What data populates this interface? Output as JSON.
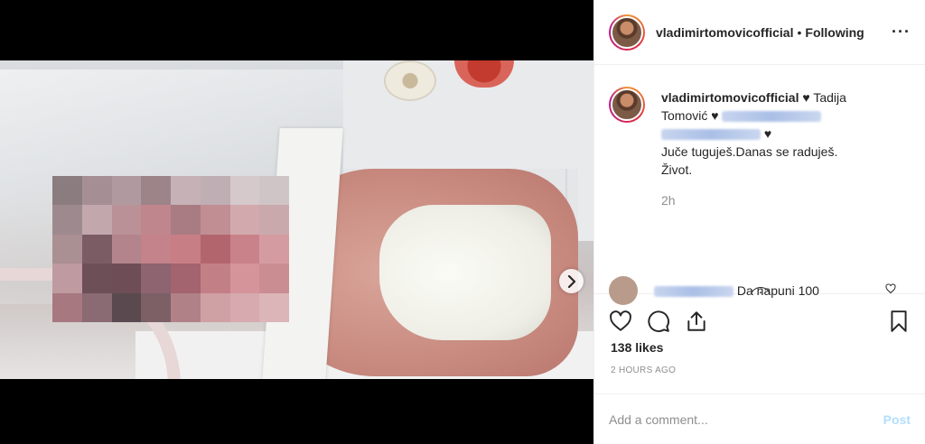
{
  "post": {
    "header": {
      "username": "vladimirtomovicofficial",
      "separator": "•",
      "follow_status": "Following",
      "more_icon": "more-horizontal-icon"
    },
    "caption": {
      "username": "vladimirtomovicofficial",
      "heart": "♥",
      "text_part1": "Tadija Tomović",
      "heart2": "♥",
      "heart3": "♥",
      "line2": "Juče tuguješ.Danas se raduješ.",
      "line3": "Život.",
      "time": "2h"
    },
    "comment_preview": {
      "text": "Da napuni 100"
    },
    "likes": "138 likes",
    "time_ago": "2 HOURS AGO",
    "add_comment": {
      "placeholder": "Add a comment...",
      "post_label": "Post"
    },
    "carousel": {
      "slides": 2,
      "active_index": 0
    },
    "colors": {
      "post_button_disabled": "#b2dffc",
      "carousel_active_dot": "#3897f0",
      "secondary_text": "#8e8e8e"
    }
  }
}
